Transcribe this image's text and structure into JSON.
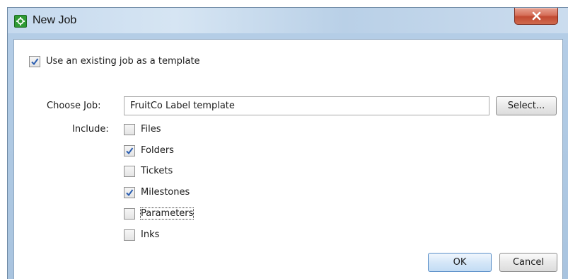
{
  "window": {
    "title": "New Job"
  },
  "use_template": {
    "label": "Use an existing job as a template",
    "checked": true
  },
  "choose_job": {
    "label": "Choose Job:",
    "value": "FruitCo Label template",
    "select_label": "Select..."
  },
  "include": {
    "label": "Include:",
    "items": [
      {
        "label": "Files",
        "checked": false
      },
      {
        "label": "Folders",
        "checked": true
      },
      {
        "label": "Tickets",
        "checked": false
      },
      {
        "label": "Milestones",
        "checked": true
      },
      {
        "label": "Parameters",
        "checked": false
      },
      {
        "label": "Inks",
        "checked": false
      }
    ]
  },
  "buttons": {
    "ok": "OK",
    "cancel": "Cancel"
  }
}
